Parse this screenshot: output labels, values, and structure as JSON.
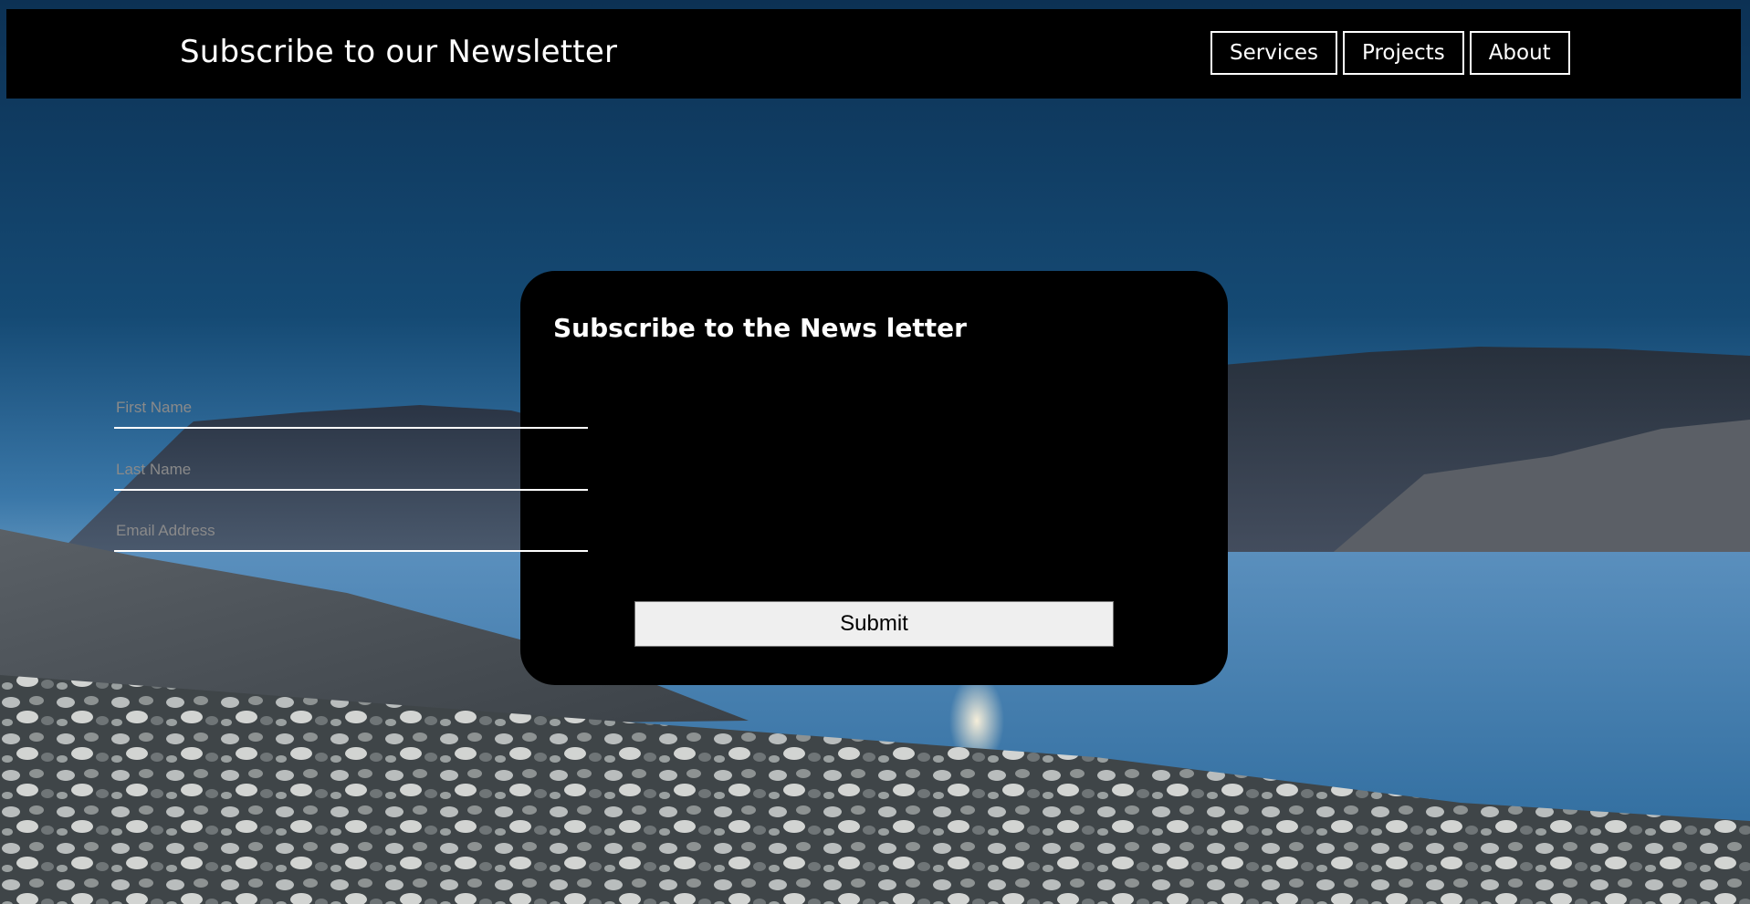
{
  "header": {
    "title": "Subscribe to our Newsletter",
    "nav": [
      {
        "label": "Services"
      },
      {
        "label": "Projects"
      },
      {
        "label": "About"
      }
    ]
  },
  "form": {
    "title": "Subscribe to the News letter",
    "first_name_placeholder": "First Name",
    "last_name_placeholder": "Last Name",
    "email_placeholder": "Email Address",
    "submit_label": "Submit"
  },
  "colors": {
    "header_bg": "#000000",
    "card_bg": "#000000",
    "text": "#ffffff",
    "submit_bg": "#efefef"
  }
}
